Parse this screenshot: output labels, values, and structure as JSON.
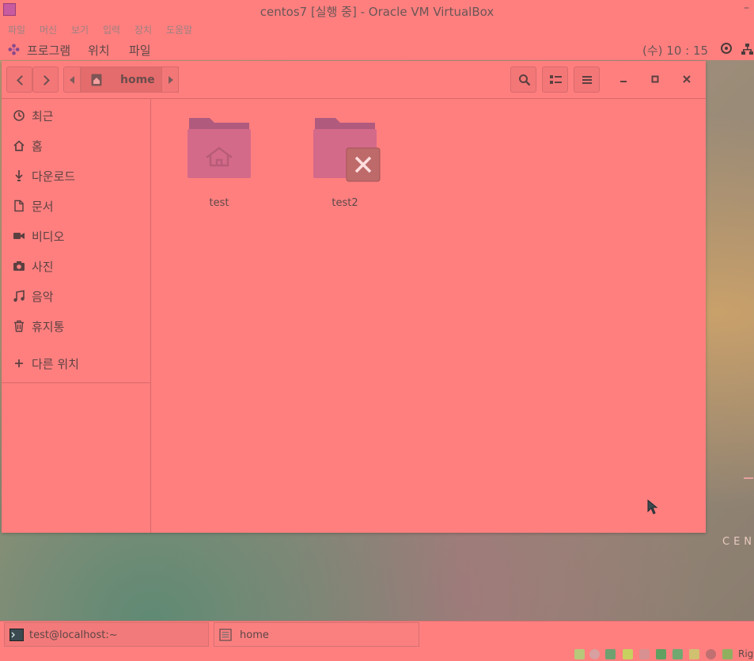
{
  "host_window": {
    "title": "centos7 [실행 중] - Oracle VM VirtualBox",
    "minimize": "–",
    "menu": [
      "파일",
      "머신",
      "보기",
      "입력",
      "장치",
      "도움말"
    ]
  },
  "top_bar": {
    "menus": [
      "프로그램",
      "위치",
      "파일"
    ],
    "clock": "(수) 10 : 15"
  },
  "file_manager": {
    "path": [
      "home"
    ],
    "sidebar": {
      "places": [
        {
          "label": "최근",
          "icon": "clock-icon"
        },
        {
          "label": "홈",
          "icon": "home-icon"
        },
        {
          "label": "다운로드",
          "icon": "download-icon"
        },
        {
          "label": "문서",
          "icon": "document-icon"
        },
        {
          "label": "비디오",
          "icon": "video-icon"
        },
        {
          "label": "사진",
          "icon": "camera-icon"
        },
        {
          "label": "음악",
          "icon": "music-icon"
        },
        {
          "label": "휴지통",
          "icon": "trash-icon"
        }
      ],
      "other_locations": "다른 위치"
    },
    "items": [
      {
        "name": "test",
        "emblem": "home-icon"
      },
      {
        "name": "test2",
        "emblem": "no-access-icon"
      }
    ]
  },
  "desktop": {
    "text": "CEN"
  },
  "taskbar": {
    "items": [
      {
        "label": "test@localhost:~",
        "icon": "terminal-icon"
      },
      {
        "label": "home",
        "icon": "file-manager-icon"
      }
    ]
  },
  "status_bar": {
    "host_key": "Rig"
  }
}
